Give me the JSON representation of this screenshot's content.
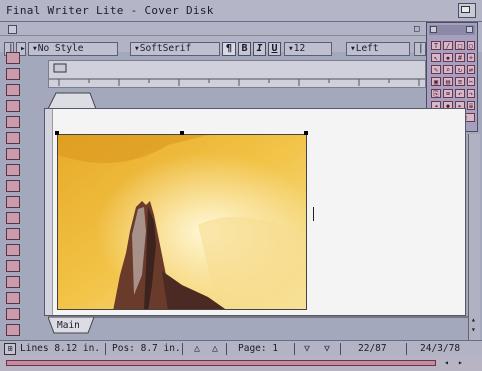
{
  "window": {
    "title": "Final Writer Lite - Cover Disk"
  },
  "toolbar": {
    "style_value": "No Style",
    "font_value": "SoftSerif",
    "bold_label": "B",
    "italic_label": "I",
    "underline_label": "U",
    "size_value": "12",
    "align_value": "Left"
  },
  "document": {
    "tab_label": "Main"
  },
  "status": {
    "lines": "Lines 8.12 in.",
    "pos": "Pos: 8.7 in.",
    "page": "Page: 1",
    "counter": "22/87",
    "date": "24/3/78"
  },
  "colors": {
    "background": "#a4a8bc",
    "page": "#f4f4f4",
    "tool_accent": "#c89cac"
  }
}
